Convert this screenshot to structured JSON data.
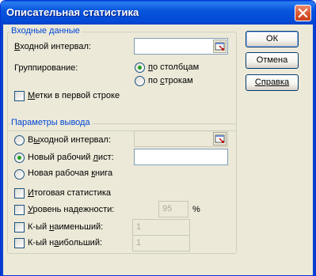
{
  "window": {
    "title": "Описательная статистика"
  },
  "buttons": {
    "ok": "ОК",
    "cancel": "Отмена",
    "help": "Справка"
  },
  "input_group": {
    "legend": "Входные данные",
    "input_range": {
      "pre": "",
      "ul": "В",
      "post": "ходной интервал:",
      "value": ""
    },
    "grouping_label": "Группирование:",
    "by_columns": {
      "pre": "",
      "ul": "п",
      "post": "о столбцам",
      "selected": true
    },
    "by_rows": {
      "pre": "по ",
      "ul": "с",
      "post": "трокам",
      "selected": false
    },
    "labels_first_row": {
      "pre": "",
      "ul": "М",
      "post": "етки в первой строке",
      "checked": false
    }
  },
  "output_group": {
    "legend": "Параметры вывода",
    "output_range": {
      "pre": "В",
      "ul": "ы",
      "post": "ходной интервал:",
      "selected": false,
      "value": ""
    },
    "new_sheet": {
      "pre": "Новый рабочий ",
      "ul": "л",
      "post": "ист:",
      "selected": true,
      "value": ""
    },
    "new_workbook": {
      "pre": "Новая рабочая ",
      "ul": "к",
      "post": "нига",
      "selected": false
    },
    "summary_stats": {
      "pre": "",
      "ul": "И",
      "post": "тоговая статистика",
      "checked": false
    },
    "confidence_level": {
      "pre": "",
      "ul": "У",
      "post": "ровень надежности:",
      "checked": false,
      "value": "95",
      "unit": "%"
    },
    "kth_smallest": {
      "pre": "К-ый ",
      "ul": "н",
      "post": "аименьший:",
      "checked": false,
      "value": "1"
    },
    "kth_largest": {
      "pre": "К-ый н",
      "ul": "а",
      "post": "ибольший:",
      "checked": false,
      "value": "1"
    }
  }
}
